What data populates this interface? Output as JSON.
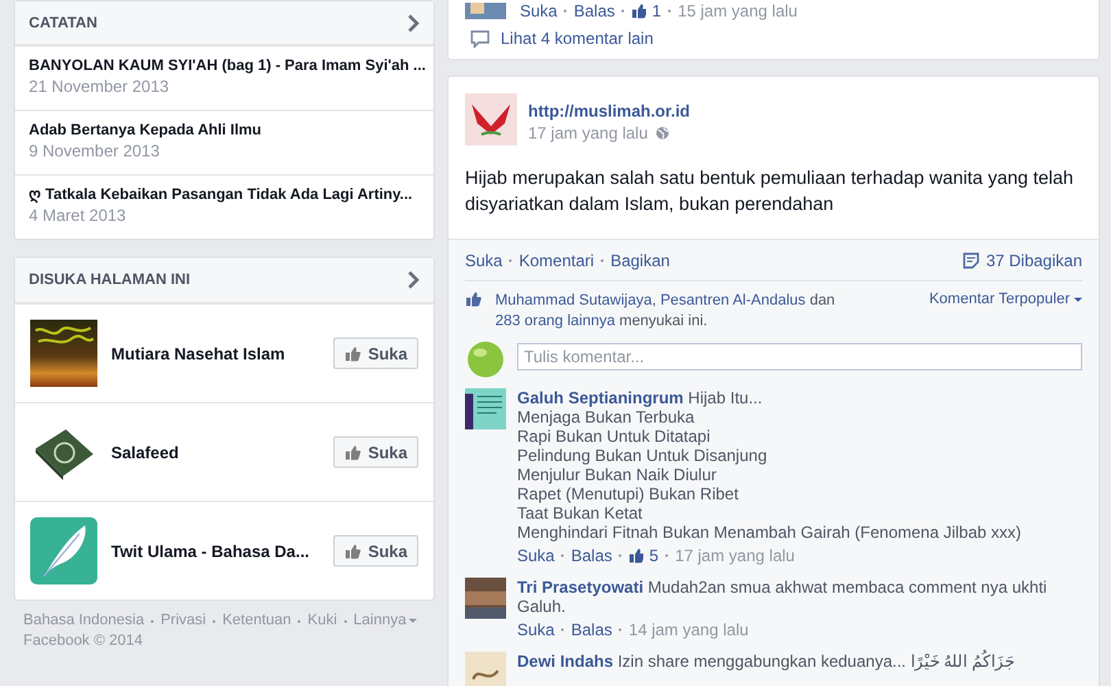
{
  "notes": {
    "title": "CATATAN",
    "items": [
      {
        "title": "BANYOLAN KAUM SYI'AH (bag 1) - Para Imam Syi'ah ...",
        "date": "21 November 2013"
      },
      {
        "title": "Adab Bertanya Kepada Ahli Ilmu",
        "date": "9 November 2013"
      },
      {
        "title": "ღ Tatkala Kebaikan Pasangan Tidak Ada Lagi Artiny...",
        "date": "4 Maret 2013"
      }
    ]
  },
  "liked_pages": {
    "title": "DISUKA HALAMAN INI",
    "items": [
      {
        "name": "Mutiara Nasehat Islam",
        "kind": "calligraphy",
        "button": "Suka"
      },
      {
        "name": "Salafeed",
        "kind": "book",
        "button": "Suka"
      },
      {
        "name": "Twit Ulama - Bahasa Da...",
        "kind": "feather",
        "button": "Suka"
      }
    ]
  },
  "footer": {
    "links": [
      "Bahasa Indonesia",
      "Privasi",
      "Ketentuan",
      "Kuki",
      "Lainnya"
    ],
    "copyright": "Facebook © 2014"
  },
  "previous_post": {
    "comment_actions": [
      "Suka",
      "Balas"
    ],
    "like_count": "1",
    "time": "15 jam yang lalu",
    "more_comments": "Lihat 4 komentar lain"
  },
  "post": {
    "author": "http://muslimah.or.id",
    "time": "17 jam yang lalu",
    "text": "Hijab merupakan salah satu bentuk pemuliaan terhadap wanita yang telah disyariatkan dalam Islam, bukan perendahan",
    "actions": [
      "Suka",
      "Komentari",
      "Bagikan"
    ],
    "shares": "37 Dibagikan",
    "likes": [
      {
        "text": "Muhammad Sutawijaya",
        "link": true
      },
      {
        "text": ", ",
        "link": false
      },
      {
        "text": "Pesantren Al-Andalus",
        "link": true
      },
      {
        "text": " dan ",
        "link": false
      },
      {
        "text": "283 orang lainnya",
        "link": true
      },
      {
        "text": " menyukai ini.",
        "link": false
      }
    ],
    "sort": "Komentar Terpopuler",
    "comment_placeholder": "Tulis komentar...",
    "comments": [
      {
        "author": "Galuh Septianingrum",
        "text": "Hijab Itu...",
        "lines": [
          "Menjaga Bukan Terbuka",
          "Rapi Bukan Untuk Ditatapi",
          "Pelindung Bukan Untuk Disanjung",
          "Menjulur Bukan Naik Diulur",
          "Rapet (Menutupi) Bukan Ribet",
          "Taat Bukan Ketat",
          "Menghindari Fitnah Bukan Menambah Gairah (Fenomena Jilbab xxx)"
        ],
        "actions": [
          "Suka",
          "Balas"
        ],
        "like_count": "5",
        "time": "17 jam yang lalu"
      },
      {
        "author": "Tri Prasetyowati",
        "text": "Mudah2an smua akhwat membaca comment nya ukhti Galuh.",
        "actions": [
          "Suka",
          "Balas"
        ],
        "time": "14 jam yang lalu"
      },
      {
        "author": "Dewi Indahs",
        "text": "Izin share menggabungkan keduanya... جَزَاكُمُ اللهُ خَيْرًا"
      }
    ]
  }
}
